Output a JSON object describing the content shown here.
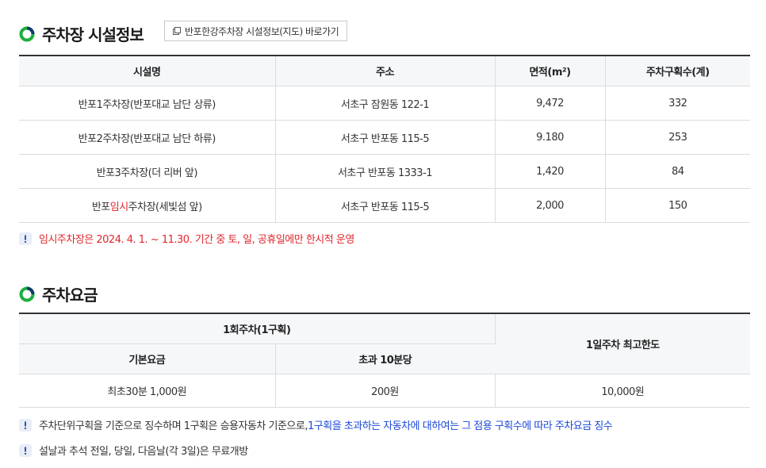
{
  "section1": {
    "title": "주차장 시설정보",
    "map_button": "반포한강주차장 시설정보(지도) 바로가기",
    "headers": [
      "시설명",
      "주소",
      "면적(m²)",
      "주차구획수(계)"
    ],
    "rows": [
      {
        "name": "반포1주차장(반포대교 남단 상류)",
        "address": "서초구 잠원동 122-1",
        "area": "9,472",
        "spaces": "332"
      },
      {
        "name": "반포2주차장(반포대교 남단 하류)",
        "address": "서초구 반포동 115-5",
        "area": "9.180",
        "spaces": "253"
      },
      {
        "name": "반포3주차장(더 리버 앞)",
        "address": "서초구 반포동 1333-1",
        "area": "1,420",
        "spaces": "84"
      },
      {
        "name_prefix": "반포",
        "name_highlight": "임시",
        "name_suffix": "주차장(세빛섬 앞)",
        "address": "서초구 반포동 115-5",
        "area": "2,000",
        "spaces": "150"
      }
    ],
    "note": "임시주차장은 2024. 4. 1. ~ 11.30. 기간 중 토, 일, 공휴일에만 한시적 운영"
  },
  "section2": {
    "title": "주차요금",
    "header_group": "1회주차(1구획)",
    "header_daily": "1일주차 최고한도",
    "header_basic": "기본요금",
    "header_extra": "초과 10분당",
    "basic_fee": "최초30분 1,000원",
    "extra_fee": "200원",
    "daily_max": "10,000원",
    "note1_plain": "주차단위구획을 기준으로 징수하며 1구획은 승용자동차 기준으로, ",
    "note1_blue": "1구획을 초과하는 자동차에 대하여는 그 점용 구획수에 따라 주차요금 징수",
    "note2": "설날과 추석 전일, 당일, 다음날(각 3일)은 무료개방"
  },
  "colors": {
    "accent_green": "#1cae3d",
    "accent_blue_dark": "#0e3a6e",
    "note_red": "#e0262c",
    "link_blue": "#1a47d8",
    "info_icon_bg": "#e8edf6"
  },
  "icons": {
    "section": "ring-section-icon",
    "link": "external-link-icon",
    "info": "exclamation-info-icon"
  }
}
